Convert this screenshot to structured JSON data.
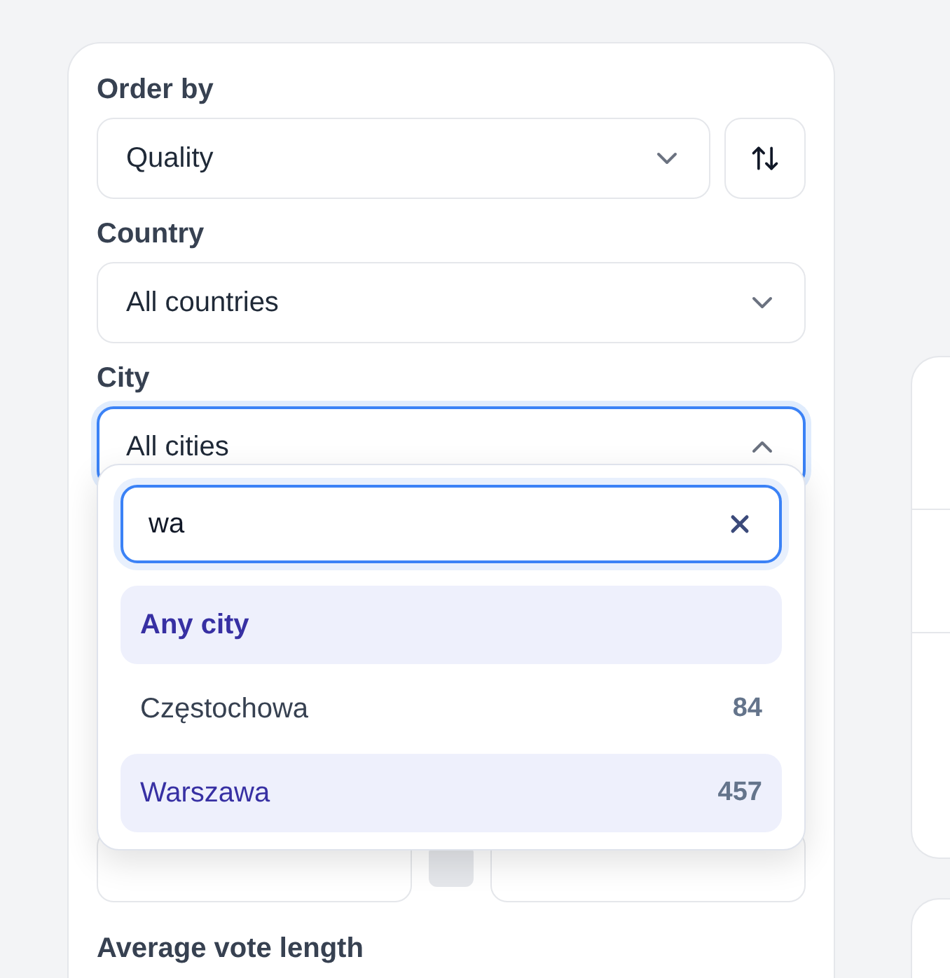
{
  "filters": {
    "order_by": {
      "label": "Order by",
      "value": "Quality",
      "expanded": false
    },
    "country": {
      "label": "Country",
      "value": "All countries",
      "expanded": false
    },
    "city": {
      "label": "City",
      "value": "All cities",
      "expanded": true,
      "search": {
        "value": "wa"
      },
      "options": [
        {
          "label": "Any city",
          "selected": true,
          "highlighted": true,
          "kind": "heading"
        },
        {
          "label": "Częstochowa",
          "count": "84",
          "selected": false,
          "highlighted": false,
          "kind": "city"
        },
        {
          "label": "Warszawa",
          "count": "457",
          "selected": false,
          "highlighted": true,
          "kind": "city"
        }
      ]
    },
    "average_vote_length": {
      "label": "Average vote length"
    }
  }
}
